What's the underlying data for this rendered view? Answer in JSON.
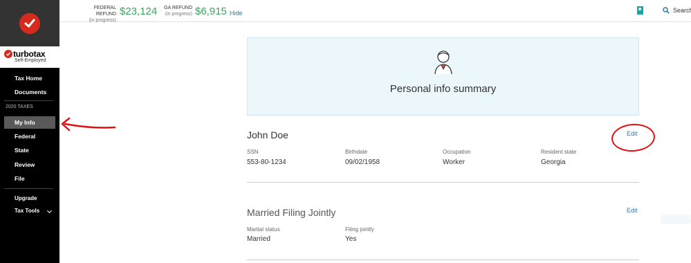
{
  "brand": {
    "name": "turbotax",
    "edition": "Self-Employed",
    "colors": {
      "red": "#d52b1e",
      "refund_green": "#3aa55c",
      "link_blue": "#2a7ab0"
    }
  },
  "sidebar": {
    "items_top": [
      {
        "label": "Tax Home"
      },
      {
        "label": "Documents"
      }
    ],
    "section_heading": "2020 TAXES",
    "items_taxes": [
      {
        "label": "My Info",
        "active": true
      },
      {
        "label": "Federal"
      },
      {
        "label": "State"
      },
      {
        "label": "Review"
      },
      {
        "label": "File"
      }
    ],
    "items_bottom": [
      {
        "label": "Upgrade"
      },
      {
        "label": "Tax Tools",
        "icon": "chevron-down-icon"
      }
    ]
  },
  "topbar": {
    "federal": {
      "label": "FEDERAL REFUND",
      "status": "(in progress)",
      "amount": "$23,124"
    },
    "state": {
      "label": "GA REFUND",
      "status": "(in progress)",
      "amount": "$6,915"
    },
    "hide_label": "Hide",
    "bookmark_icon": "bookmark-icon",
    "search_label": "Search"
  },
  "summary": {
    "title": "Personal info summary",
    "icon": "person-avatar-icon"
  },
  "person": {
    "name": "John Doe",
    "edit_label": "Edit",
    "fields": [
      {
        "label": "SSN",
        "value": "553-80-1234"
      },
      {
        "label": "Birthdate",
        "value": "09/02/1958"
      },
      {
        "label": "Occupation",
        "value": "Worker"
      },
      {
        "label": "Resident state",
        "value": "Georgia"
      }
    ]
  },
  "filing": {
    "title": "Married Filing Jointly",
    "edit_label": "Edit",
    "fields": [
      {
        "label": "Marital status",
        "value": "Married"
      },
      {
        "label": "Filing jointly",
        "value": "Yes"
      }
    ]
  }
}
